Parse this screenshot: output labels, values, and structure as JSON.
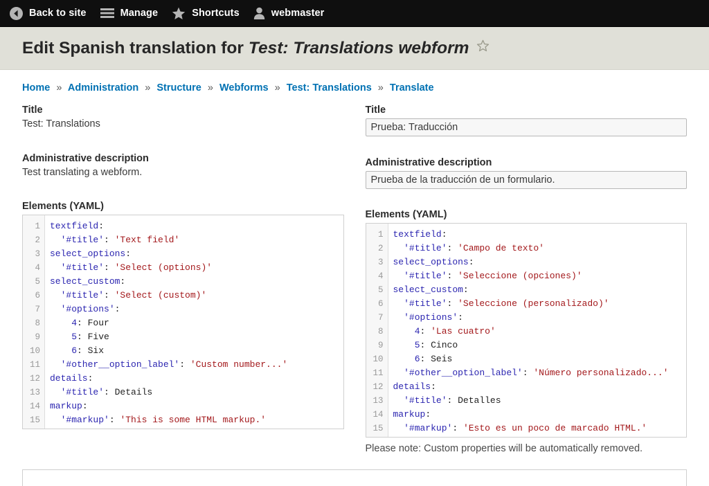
{
  "toolbar": {
    "items": [
      {
        "label": "Back to site",
        "icon": "back-arrow-circle-icon"
      },
      {
        "label": "Manage",
        "icon": "hamburger-menu-icon"
      },
      {
        "label": "Shortcuts",
        "icon": "star-filled-icon"
      },
      {
        "label": "webmaster",
        "icon": "user-avatar-icon"
      }
    ]
  },
  "page": {
    "title_prefix": "Edit Spanish translation for",
    "title_emphasis": "Test: Translations webform",
    "flag_icon": "star-outline-icon"
  },
  "breadcrumb": {
    "separator": "»",
    "items": [
      "Home",
      "Administration",
      "Structure",
      "Webforms",
      "Test: Translations",
      "Translate"
    ]
  },
  "source": {
    "title_label": "Title",
    "title_value": "Test: Translations",
    "description_label": "Administrative description",
    "description_value": "Test translating a webform.",
    "elements_label": "Elements (YAML)",
    "yaml_lines": [
      [
        {
          "t": "textfield",
          "c": "key"
        },
        {
          "t": ":",
          "c": "punc"
        }
      ],
      [
        {
          "t": "  '#title'",
          "c": "key"
        },
        {
          "t": ": ",
          "c": "punc"
        },
        {
          "t": "'Text field'",
          "c": "str"
        }
      ],
      [
        {
          "t": "select_options",
          "c": "key"
        },
        {
          "t": ":",
          "c": "punc"
        }
      ],
      [
        {
          "t": "  '#title'",
          "c": "key"
        },
        {
          "t": ": ",
          "c": "punc"
        },
        {
          "t": "'Select (options)'",
          "c": "str"
        }
      ],
      [
        {
          "t": "select_custom",
          "c": "key"
        },
        {
          "t": ":",
          "c": "punc"
        }
      ],
      [
        {
          "t": "  '#title'",
          "c": "key"
        },
        {
          "t": ": ",
          "c": "punc"
        },
        {
          "t": "'Select (custom)'",
          "c": "str"
        }
      ],
      [
        {
          "t": "  '#options'",
          "c": "key"
        },
        {
          "t": ":",
          "c": "punc"
        }
      ],
      [
        {
          "t": "    4",
          "c": "key"
        },
        {
          "t": ": ",
          "c": "punc"
        },
        {
          "t": "Four",
          "c": "plain"
        }
      ],
      [
        {
          "t": "    5",
          "c": "key"
        },
        {
          "t": ": ",
          "c": "punc"
        },
        {
          "t": "Five",
          "c": "plain"
        }
      ],
      [
        {
          "t": "    6",
          "c": "key"
        },
        {
          "t": ": ",
          "c": "punc"
        },
        {
          "t": "Six",
          "c": "plain"
        }
      ],
      [
        {
          "t": "  '#other__option_label'",
          "c": "key"
        },
        {
          "t": ": ",
          "c": "punc"
        },
        {
          "t": "'Custom number...'",
          "c": "str"
        }
      ],
      [
        {
          "t": "details",
          "c": "key"
        },
        {
          "t": ":",
          "c": "punc"
        }
      ],
      [
        {
          "t": "  '#title'",
          "c": "key"
        },
        {
          "t": ": ",
          "c": "punc"
        },
        {
          "t": "Details",
          "c": "plain"
        }
      ],
      [
        {
          "t": "markup",
          "c": "key"
        },
        {
          "t": ":",
          "c": "punc"
        }
      ],
      [
        {
          "t": "  '#markup'",
          "c": "key"
        },
        {
          "t": ": ",
          "c": "punc"
        },
        {
          "t": "'This is some HTML markup.'",
          "c": "str"
        }
      ]
    ]
  },
  "translation": {
    "title_label": "Title",
    "title_value": "Prueba: Traducción",
    "description_label": "Administrative description",
    "description_value": "Prueba de la traducción de un formulario.",
    "elements_label": "Elements (YAML)",
    "note": "Please note: Custom properties will be automatically removed.",
    "yaml_lines": [
      [
        {
          "t": "textfield",
          "c": "key"
        },
        {
          "t": ":",
          "c": "punc"
        }
      ],
      [
        {
          "t": "  '#title'",
          "c": "key"
        },
        {
          "t": ": ",
          "c": "punc"
        },
        {
          "t": "'Campo de texto'",
          "c": "str"
        }
      ],
      [
        {
          "t": "select_options",
          "c": "key"
        },
        {
          "t": ":",
          "c": "punc"
        }
      ],
      [
        {
          "t": "  '#title'",
          "c": "key"
        },
        {
          "t": ": ",
          "c": "punc"
        },
        {
          "t": "'Seleccione (opciones)'",
          "c": "str"
        }
      ],
      [
        {
          "t": "select_custom",
          "c": "key"
        },
        {
          "t": ":",
          "c": "punc"
        }
      ],
      [
        {
          "t": "  '#title'",
          "c": "key"
        },
        {
          "t": ": ",
          "c": "punc"
        },
        {
          "t": "'Seleccione (personalizado)'",
          "c": "str"
        }
      ],
      [
        {
          "t": "  '#options'",
          "c": "key"
        },
        {
          "t": ":",
          "c": "punc"
        }
      ],
      [
        {
          "t": "    4",
          "c": "key"
        },
        {
          "t": ": ",
          "c": "punc"
        },
        {
          "t": "'Las cuatro'",
          "c": "str"
        }
      ],
      [
        {
          "t": "    5",
          "c": "key"
        },
        {
          "t": ": ",
          "c": "punc"
        },
        {
          "t": "Cinco",
          "c": "plain"
        }
      ],
      [
        {
          "t": "    6",
          "c": "key"
        },
        {
          "t": ": ",
          "c": "punc"
        },
        {
          "t": "Seis",
          "c": "plain"
        }
      ],
      [
        {
          "t": "  '#other__option_label'",
          "c": "key"
        },
        {
          "t": ": ",
          "c": "punc"
        },
        {
          "t": "'Número personalizado...'",
          "c": "str"
        }
      ],
      [
        {
          "t": "details",
          "c": "key"
        },
        {
          "t": ":",
          "c": "punc"
        }
      ],
      [
        {
          "t": "  '#title'",
          "c": "key"
        },
        {
          "t": ": ",
          "c": "punc"
        },
        {
          "t": "Detalles",
          "c": "plain"
        }
      ],
      [
        {
          "t": "markup",
          "c": "key"
        },
        {
          "t": ":",
          "c": "punc"
        }
      ],
      [
        {
          "t": "  '#markup'",
          "c": "key"
        },
        {
          "t": ": ",
          "c": "punc"
        },
        {
          "t": "'Esto es un poco de marcado HTML.'",
          "c": "str"
        }
      ]
    ]
  },
  "colors": {
    "toolbar_bg": "#0f0f0f",
    "title_band_bg": "#e0e0d8",
    "link": "#0071b3",
    "yaml_key": "#2b25b0",
    "yaml_string": "#a3181b"
  }
}
